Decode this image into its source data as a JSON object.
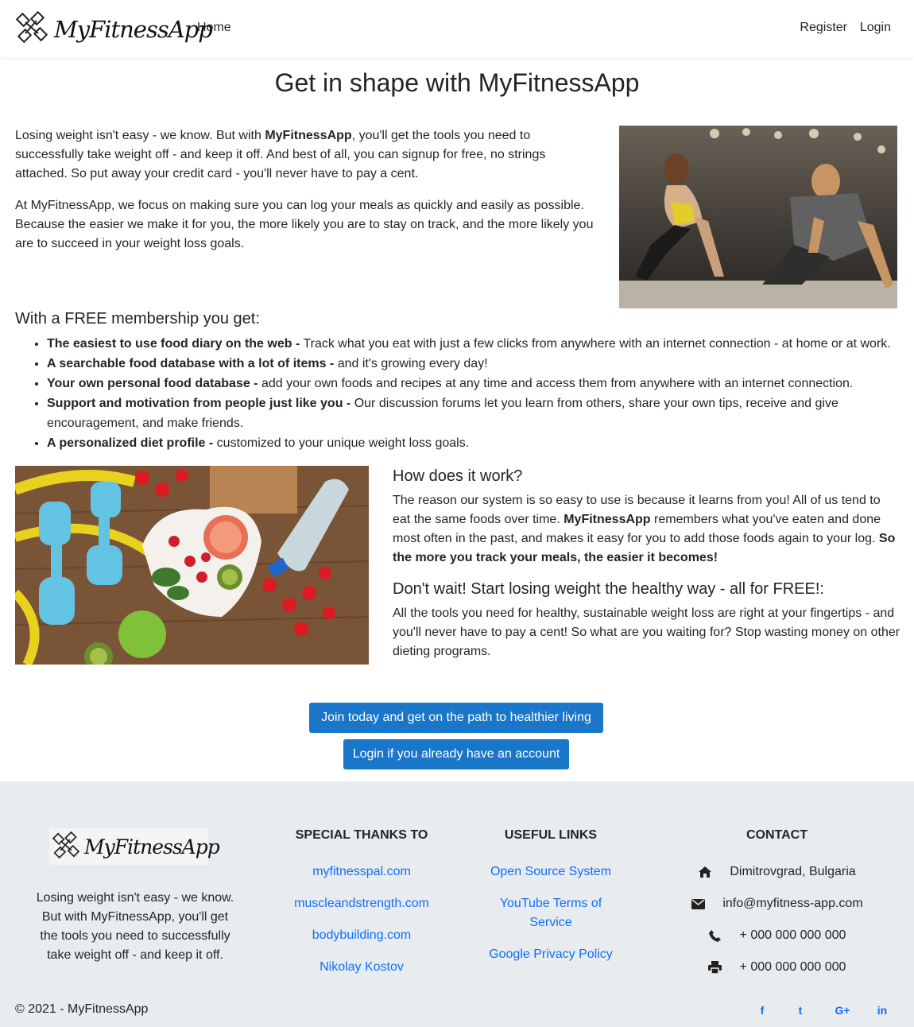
{
  "navbar": {
    "brand": "MyFitnessApp",
    "home": "Home",
    "register": "Register",
    "login": "Login"
  },
  "page_title": "Get in shape with MyFitnessApp",
  "intro": {
    "p1_pre": "Losing weight isn't easy - we know. But with ",
    "p1_bold": "MyFitnessApp",
    "p1_post": ", you'll get the tools you need to successfully take weight off - and keep it off. And best of all, you can signup for free, no strings attached. So put away your credit card - you'll never have to pay a cent.",
    "p2": "At MyFitnessApp, we focus on making sure you can log your meals as quickly and easily as possible. Because the easier we make it for you, the more likely you are to stay on track, and the more likely you are to succeed in your weight loss goals."
  },
  "membership": {
    "heading": "With a FREE membership you get:",
    "items": [
      {
        "bold": "The easiest to use food diary on the web -",
        "text": " Track what you eat with just a few clicks from anywhere with an internet connection - at home or at work."
      },
      {
        "bold": "A searchable food database with a lot of items -",
        "text": " and it's growing every day!"
      },
      {
        "bold": "Your own personal food database -",
        "text": " add your own foods and recipes at any time and access them from anywhere with an internet connection."
      },
      {
        "bold": "Support and motivation from people just like you -",
        "text": " Our discussion forums let you learn from others, share your own tips, receive and give encouragement, and make friends."
      },
      {
        "bold": "A personalized diet profile -",
        "text": " customized to your unique weight loss goals."
      }
    ]
  },
  "how": {
    "heading": "How does it work?",
    "p_pre": "The reason our system is so easy to use is because it learns from you! All of us tend to eat the same foods over time. ",
    "p_bold1": "MyFitnessApp",
    "p_mid": " remembers what you've eaten and done most often in the past, and makes it easy for you to add those foods again to your log. ",
    "p_bold2": "So the more you track your meals, the easier it becomes!",
    "heading2": "Don't wait! Start losing weight the healthy way - all for FREE!:",
    "p2": "All the tools you need for healthy, sustainable weight loss are right at your fingertips - and you'll never have to pay a cent! So what are you waiting for? Stop wasting money on other dieting programs."
  },
  "buttons": {
    "join": "Join today and get on the path to healthier living",
    "login": "Login if you already have an account"
  },
  "footer": {
    "brand": "MyFitnessApp",
    "description": "Losing weight isn't easy - we know. But with MyFitnessApp, you'll get the tools you need to successfully take weight off - and keep it off.",
    "thanks": {
      "heading": "SPECIAL THANKS TO",
      "links": [
        "myfitnesspal.com",
        "muscleandstrength.com",
        "bodybuilding.com",
        "Nikolay Kostov"
      ]
    },
    "useful": {
      "heading": "USEFUL LINKS",
      "links": [
        "Open Source System",
        "YouTube Terms of Service",
        "Google Privacy Policy"
      ]
    },
    "contact": {
      "heading": "CONTACT",
      "address": "Dimitrovgrad, Bulgaria",
      "email": "info@myfitness-app.com",
      "phone": "+ 000 000 000 000",
      "fax": "+ 000 000 000 000"
    },
    "copyright": "© 2021 - MyFitnessApp",
    "social": {
      "facebook": "f",
      "twitter": "t",
      "google": "G+",
      "linkedin": "in"
    },
    "colors": {
      "link": "#0d6efd",
      "button": "#1976c8",
      "footer_bg": "#e9ecef"
    }
  }
}
